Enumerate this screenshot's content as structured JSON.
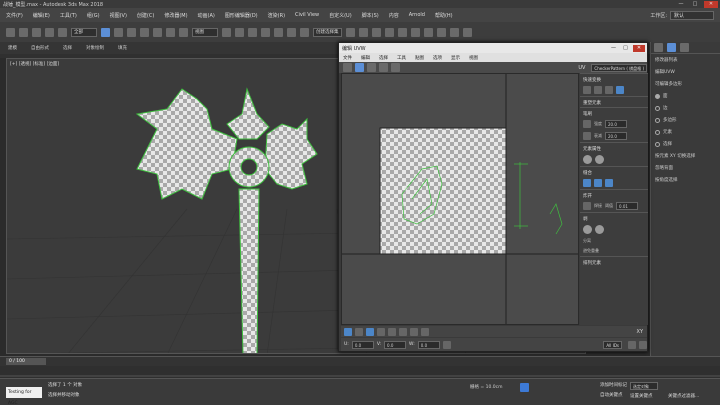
{
  "window": {
    "title": "战锤_模型.max - Autodesk 3ds Max 2018",
    "minimize": "—",
    "maximize": "□",
    "close": "✕"
  },
  "menubar": {
    "items": [
      "文件(F)",
      "编辑(E)",
      "工具(T)",
      "组(G)",
      "视图(V)",
      "创建(C)",
      "修改器(M)",
      "动画(A)",
      "图形编辑器(D)",
      "渲染(R)",
      "Civil View",
      "自定义(U)",
      "脚本(S)",
      "内容",
      "Arnold",
      "帮助(H)"
    ],
    "workspace_label": "工作区:",
    "workspace_value": "默认"
  },
  "toolbar": {
    "selection_filter": "全部",
    "reference_coord": "视图",
    "named_set": "创建选择集"
  },
  "ribbon": {
    "tabs": [
      "建模",
      "自由形式",
      "选择",
      "对象绘制",
      "填充"
    ]
  },
  "subribbon": {
    "label": "多边形建模"
  },
  "viewport": {
    "label": "[+] [透视] [标准] [边面]"
  },
  "uvw_editor": {
    "title": "编辑 UVW",
    "menu": [
      "文件",
      "编辑",
      "选择",
      "工具",
      "贴图",
      "选项",
      "显示",
      "视图"
    ],
    "uv_label": "UV",
    "checker_dropdown": "CheckerPattern ( 棋盘格 )",
    "sections": {
      "quick_transform": "快速变换",
      "reshape": "重塑元素",
      "brush": "笔刷",
      "stitch": "缝合",
      "explode": "炸开",
      "weld": "焊接",
      "peel": "剥",
      "arrange": "排列元素",
      "element_props": "元素属性"
    },
    "brush_labels": {
      "strength": "强度",
      "falloff": "衰减",
      "strength_value": "20.0",
      "falloff_value": "20.0"
    },
    "weld_labels": {
      "threshold": "阈值",
      "threshold_value": "0.01"
    },
    "peel_labels": {
      "detach": "分离",
      "avoid": "避免重叠"
    },
    "bottom": {
      "xy": "XY",
      "u_label": "U:",
      "v_label": "V:",
      "w_label": "W:",
      "u_value": "0.0",
      "v_value": "0.0",
      "w_value": "0.0",
      "zoom": "All IDs"
    }
  },
  "right_panel": {
    "header": "修改器列表",
    "items": [
      "编辑UVW",
      "可编辑多边形"
    ],
    "options": [
      "面",
      "边",
      "多边形",
      "元素",
      "选择"
    ],
    "labels": [
      "按元素 XY 切换选择",
      "忽略背面",
      "按角度选择"
    ]
  },
  "timeline": {
    "frame": "0 / 100"
  },
  "status": {
    "script": "Testing for AGC",
    "line1": "选择了 1 个 对象",
    "line2": "选择并移动对象",
    "grid": "栅格 = 10.0cm",
    "add_time_tag": "添加时间标记",
    "auto_key": "自动关键点",
    "set_key": "设置关键点",
    "selected": "选定对象",
    "key_filters": "关键点过滤器..."
  }
}
